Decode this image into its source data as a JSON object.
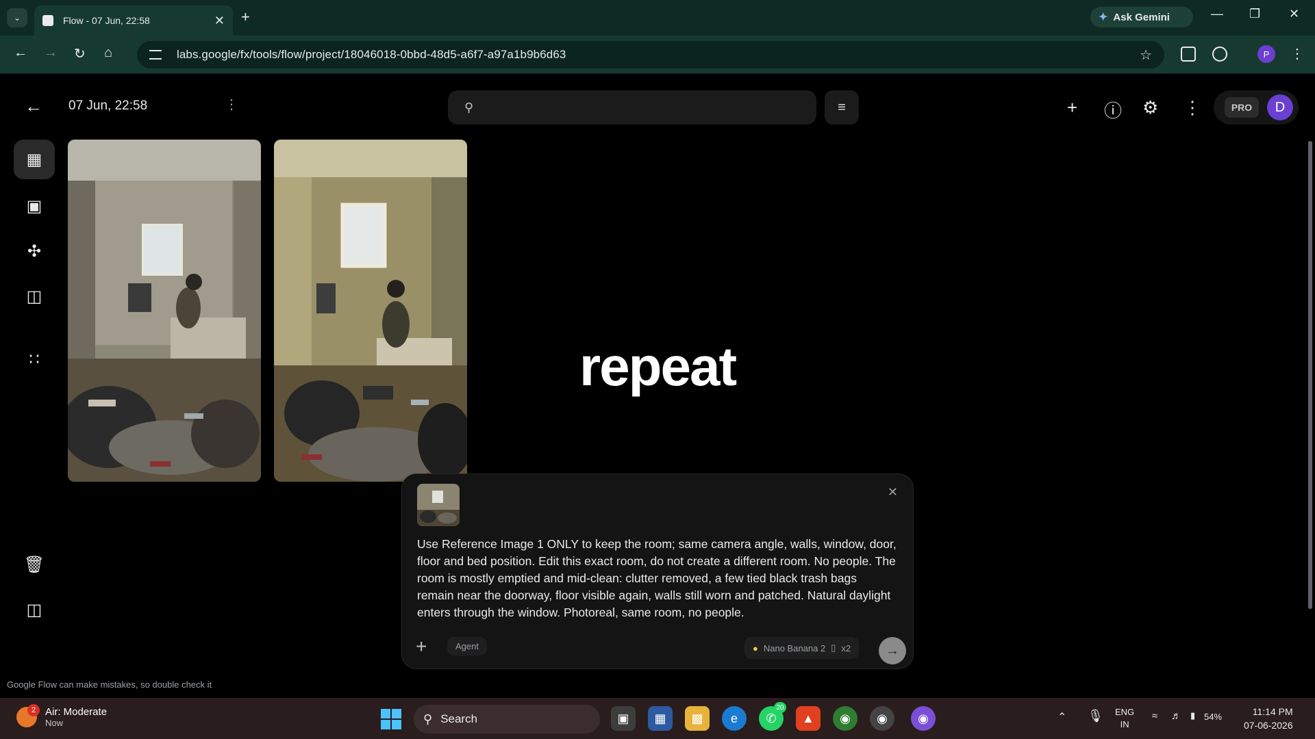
{
  "browser": {
    "tab_title": "Flow - 07 Jun, 22:58",
    "tab_close": "✕",
    "new_tab": "+",
    "ask_gemini": "Ask Gemini",
    "url": "labs.google/fx/tools/flow/project/18046018-0bbd-48d5-a6f7-a97a1b9b6d63",
    "profile_initial": "P",
    "accent": "#163a30"
  },
  "app": {
    "title": "07 Jun, 22:58",
    "search_placeholder": "",
    "pro_label": "PRO",
    "avatar_initial": "D",
    "overlay_word": "repeat",
    "disclaimer": "Google Flow can make mistakes, so double check it"
  },
  "rail": {
    "items": [
      {
        "name": "grid-icon"
      },
      {
        "name": "image-icon"
      },
      {
        "name": "person-icon"
      },
      {
        "name": "video-icon"
      },
      {
        "name": "apps-sparkle-icon"
      },
      {
        "name": "trash-icon"
      },
      {
        "name": "sidebar-panel-icon"
      }
    ]
  },
  "prompt": {
    "text": "Use Reference Image 1 ONLY to keep the room; same camera angle, walls, window, door, floor and bed position. Edit this exact room, do not create a different room. No people. The room is mostly emptied and mid-clean: clutter removed, a few tied black trash bags remain near the doorway, floor visible again, walls still worn and patched. Natural daylight enters through the window. Photoreal, same room, no people.",
    "agent_label": "Agent",
    "model_label": "Nano Banana 2",
    "count_label": "x2",
    "close": "✕",
    "plus": "+"
  },
  "taskbar": {
    "weather_title": "Air: Moderate",
    "weather_sub": "Now",
    "weather_badge": "2",
    "search_label": "Search",
    "whatsapp_badge": "20",
    "lang_top": "ENG",
    "lang_bottom": "IN",
    "battery": "54%",
    "time": "11:14 PM",
    "date": "07-06-2026"
  }
}
